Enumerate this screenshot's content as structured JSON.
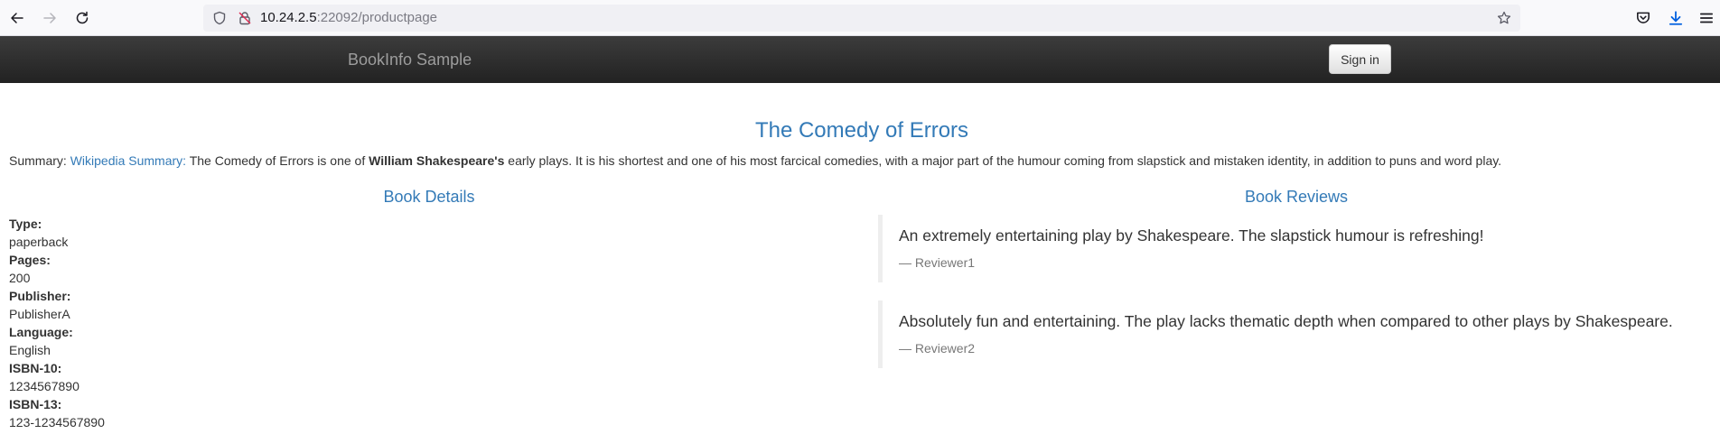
{
  "browser": {
    "url_host": "10.24.2.5",
    "url_rest": ":22092/productpage",
    "icons": {
      "back": "back-arrow-icon",
      "forward": "forward-arrow-icon",
      "reload": "reload-icon",
      "tracking": "shield-icon",
      "security": "lock-icon",
      "bookmark": "star-icon",
      "pocket": "pocket-icon",
      "downloads": "download-icon",
      "menu": "hamburger-menu-icon"
    }
  },
  "navbar": {
    "brand": "BookInfo Sample",
    "signin_label": "Sign in"
  },
  "book": {
    "title": "The Comedy of Errors",
    "summary_label": "Summary:",
    "summary_link": "Wikipedia Summary:",
    "summary_pre": "The Comedy of Errors is one of",
    "summary_bold": "William Shakespeare's",
    "summary_post": "early plays. It is his shortest and one of his most farcical comedies, with a major part of the humour coming from slapstick and mistaken identity, in addition to puns and word play."
  },
  "details": {
    "heading": "Book Details",
    "items": [
      {
        "label": "Type:",
        "value": "paperback"
      },
      {
        "label": "Pages:",
        "value": "200"
      },
      {
        "label": "Publisher:",
        "value": "PublisherA"
      },
      {
        "label": "Language:",
        "value": "English"
      },
      {
        "label": "ISBN-10:",
        "value": "1234567890"
      },
      {
        "label": "ISBN-13:",
        "value": "123-1234567890"
      }
    ]
  },
  "reviews": {
    "heading": "Book Reviews",
    "items": [
      {
        "text": "An extremely entertaining play by Shakespeare. The slapstick humour is refreshing!",
        "author": "— Reviewer1"
      },
      {
        "text": "Absolutely fun and entertaining. The play lacks thematic depth when compared to other plays by Shakespeare.",
        "author": "— Reviewer2"
      }
    ]
  },
  "colors": {
    "link": "#337ab7",
    "navbar_top": "#3c3c3c",
    "navbar_bottom": "#222222",
    "brand": "#9d9d9d",
    "muted": "#777777"
  }
}
